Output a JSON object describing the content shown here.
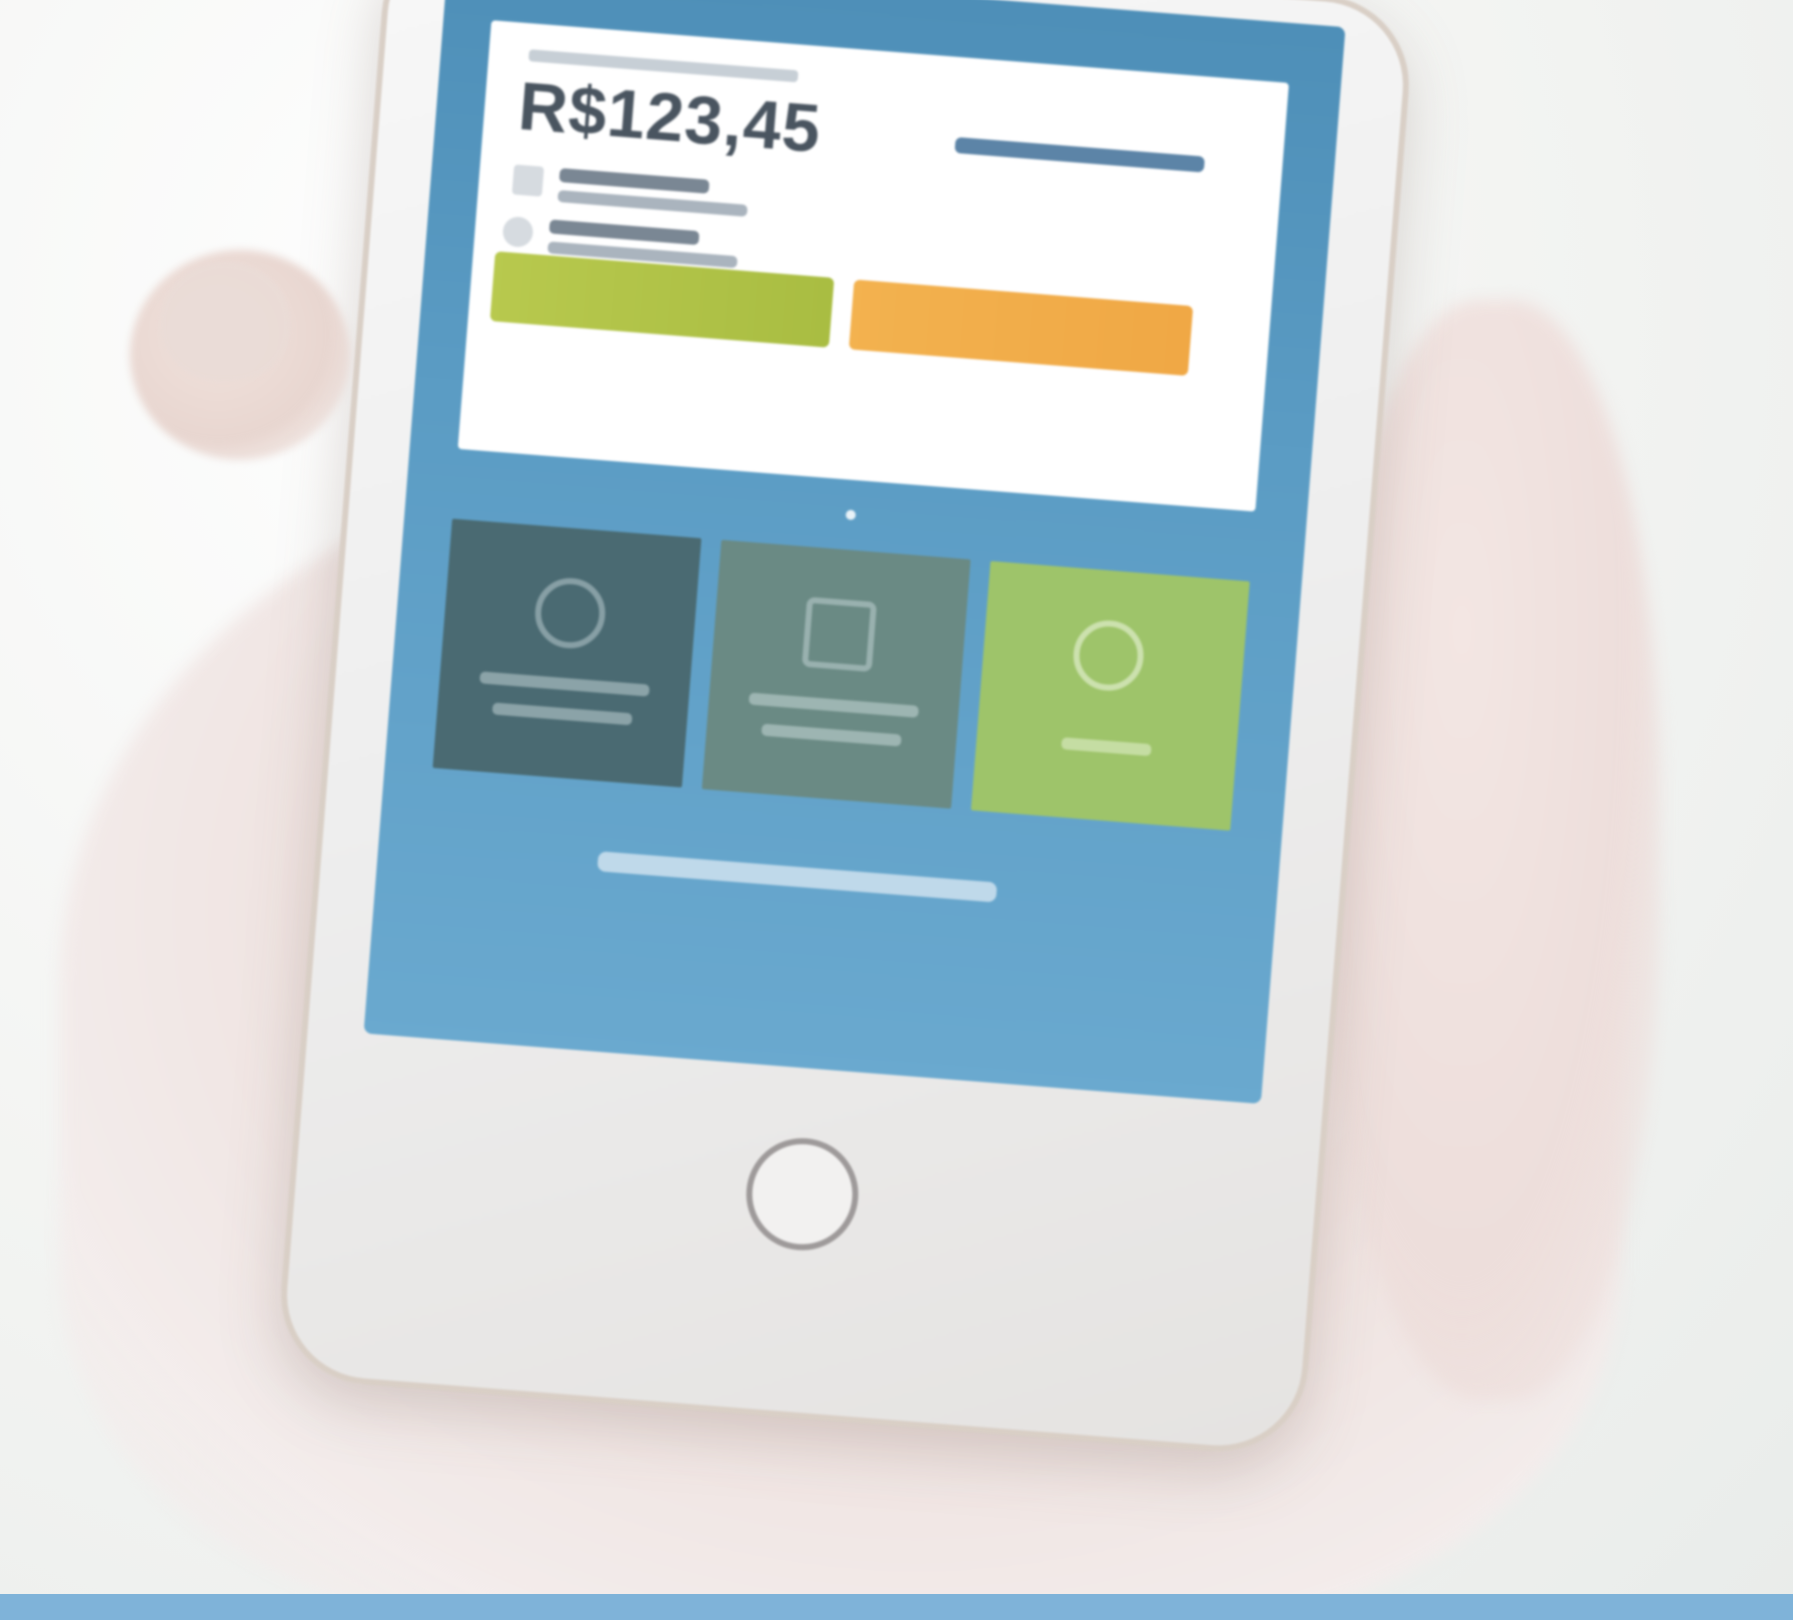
{
  "phone_screen": {
    "amount": "R$123,45"
  },
  "colors": {
    "screen_blue": "#5b9cc4",
    "primary_button": "#b8c94e",
    "secondary_button": "#f3b24f",
    "amount_text": "#4a5560"
  }
}
